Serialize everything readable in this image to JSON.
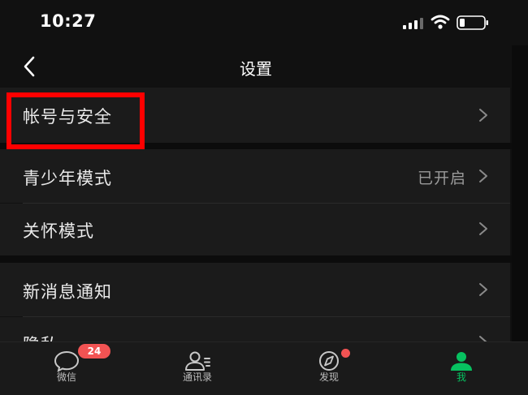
{
  "status_bar": {
    "time": "10:27"
  },
  "nav": {
    "title": "设置"
  },
  "rows": [
    {
      "label": "帐号与安全",
      "value": ""
    },
    {
      "label": "青少年模式",
      "value": "已开启"
    },
    {
      "label": "关怀模式",
      "value": ""
    },
    {
      "label": "新消息通知",
      "value": ""
    },
    {
      "label": "隐私",
      "value": ""
    }
  ],
  "tabs": [
    {
      "label": "微信",
      "badge": "24",
      "icon": "chat-bubble-icon"
    },
    {
      "label": "通讯录",
      "icon": "contacts-icon"
    },
    {
      "label": "发现",
      "icon": "compass-icon"
    },
    {
      "label": "我",
      "icon": "person-icon",
      "active": true
    }
  ],
  "colors": {
    "active_tab": "#07c160",
    "badge": "#f25353",
    "highlight": "#ff0000",
    "row_bg": "#1b1b1b",
    "page_bg": "#111111"
  }
}
